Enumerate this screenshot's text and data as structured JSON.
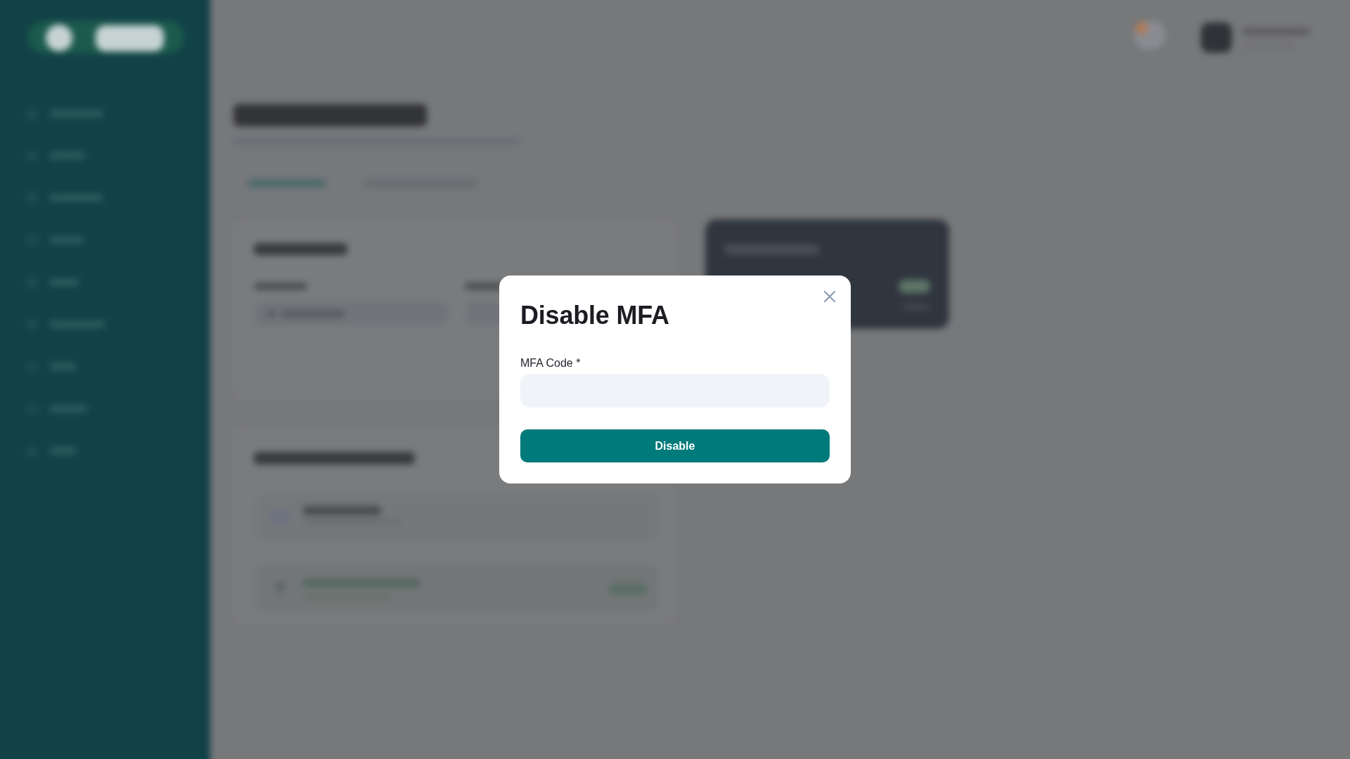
{
  "dialog": {
    "title": "Disable MFA",
    "fields": [
      {
        "label": "MFA Code *"
      }
    ],
    "submit_button": {
      "label": "Disable"
    }
  }
}
